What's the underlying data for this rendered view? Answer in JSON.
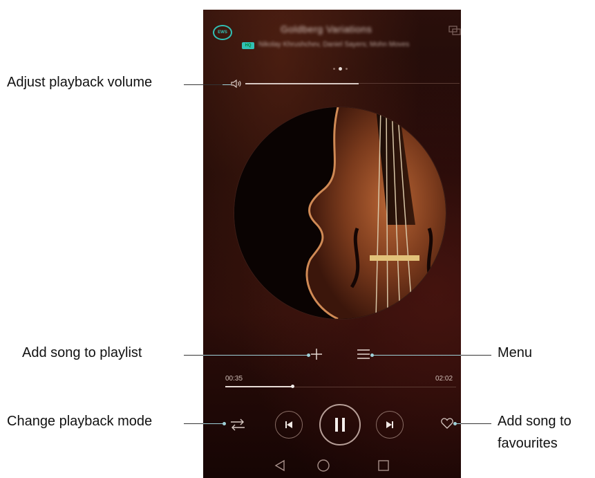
{
  "player": {
    "badge": "EWS",
    "title": "Goldberg Variations",
    "quality": "HQ",
    "subtitle": "Nikolay Khrushchev, Daniel Sayers; Mohn Moves",
    "elapsed": "00:35",
    "duration": "02:02",
    "progress_fraction": 0.29,
    "volume_fraction": 0.53,
    "page_indicator": {
      "count": 3,
      "active": 1
    }
  },
  "callouts": {
    "volume": "Adjust playback volume",
    "add_playlist": "Add song to playlist",
    "menu": "Menu",
    "mode": "Change playback mode",
    "fav_line1": "Add song to",
    "fav_line2": "favourites"
  },
  "icons": {
    "ews": "ews-badge-icon",
    "cast": "screen-cast-icon",
    "volume": "speaker-icon",
    "add": "plus-icon",
    "menu": "menu-lines-icon",
    "mode": "shuffle-icon",
    "prev": "previous-track-icon",
    "play_pause": "pause-icon",
    "next": "next-track-icon",
    "favourite": "heart-icon",
    "back": "back-triangle-icon",
    "home": "home-circle-icon",
    "recents": "recents-square-icon"
  },
  "colors": {
    "accent": "#31c0b5",
    "background_dark": "#1b0806",
    "leader_line": "#9fd1d9"
  }
}
